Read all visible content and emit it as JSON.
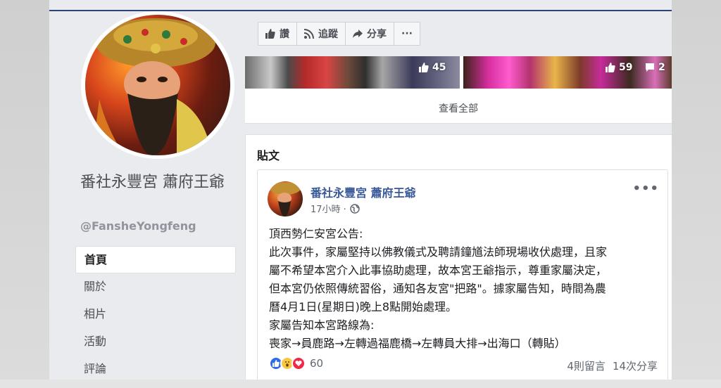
{
  "page": {
    "name": "番社永豐宮 蕭府王爺",
    "handle": "@FansheYongfeng"
  },
  "nav": {
    "items": [
      {
        "label": "首頁",
        "active": true
      },
      {
        "label": "關於",
        "active": false
      },
      {
        "label": "相片",
        "active": false
      },
      {
        "label": "活動",
        "active": false
      },
      {
        "label": "評論",
        "active": false
      }
    ]
  },
  "actions": {
    "like": "讚",
    "follow": "追蹤",
    "share": "分享",
    "more": "···"
  },
  "photos": {
    "photo1_likes": "45",
    "photo2_likes": "59",
    "photo2_comments": "2",
    "see_all": "查看全部"
  },
  "posts": {
    "title": "貼文",
    "post": {
      "author": "番社永豐宮 蕭府王爺",
      "time": "17小時 ·",
      "more": "•••",
      "lines": [
        "頂西勢仁安宮公告:",
        "此次事件，家屬堅持以佛教儀式及聘請鐘馗法師現場收伏處理，且家",
        "屬不希望本宮介入此事協助處理，故本宮王爺指示，尊重家屬決定，",
        "但本宮仍依照傳統習俗，通知各友宮\"把路\"。據家屬告知，時間為農",
        "曆4月1日(星期日)晚上8點開始處理。",
        "家屬告知本宮路線為:",
        "喪家→員鹿路→左轉過福鹿橋→左轉員大排→出海口（轉貼）"
      ],
      "reaction_count": "60",
      "comments": "4則留言",
      "shares": "14次分享"
    }
  },
  "colors": {
    "link": "#385898",
    "background": "#e9ebee",
    "topline": "#2d4373"
  }
}
